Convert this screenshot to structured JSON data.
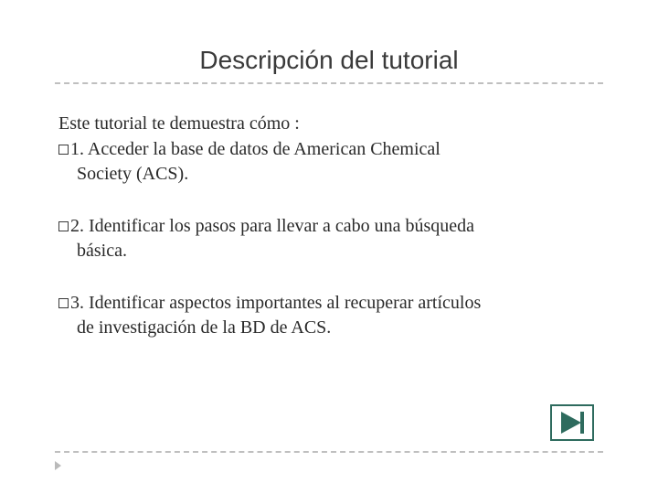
{
  "title": "Descripción del tutorial",
  "intro": "Este tutorial te demuestra cómo :",
  "items": [
    {
      "number": "1.",
      "text_line1": "Acceder  la base de datos de American Chemical",
      "text_line2": "Society (ACS)."
    },
    {
      "number": "2.",
      "text_line1": "Identificar  los pasos para llevar a cabo una  búsqueda",
      "text_line2": "básica."
    },
    {
      "number": "3.",
      "text_line1": "Identificar aspectos importantes al recuperar artículos",
      "text_line2": "de investigación de la BD de ACS."
    }
  ],
  "nav": {
    "next_icon": "play-forward-icon"
  }
}
